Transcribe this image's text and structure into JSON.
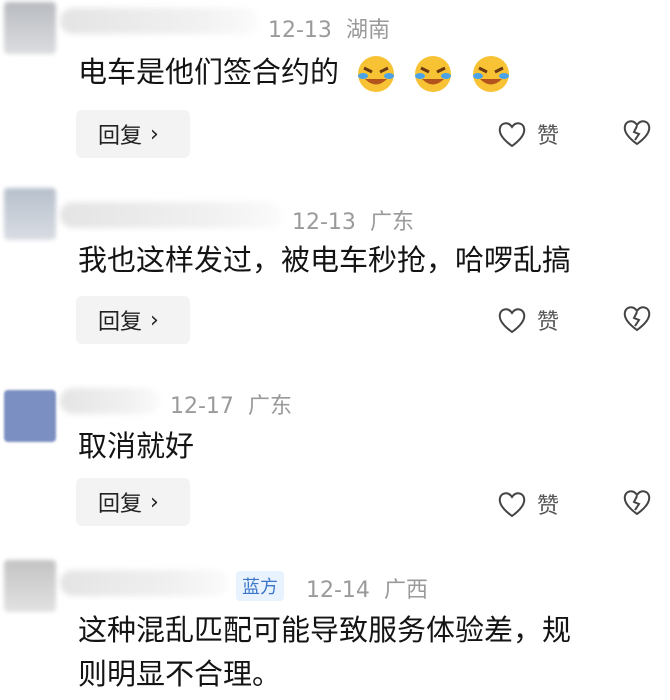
{
  "comments": [
    {
      "date": "12-13",
      "location": "湖南",
      "text": "电车是他们签合约的",
      "emojis": [
        "laughing-crying-emoji",
        "laughing-crying-emoji",
        "laughing-crying-emoji"
      ],
      "reply_label": "回复",
      "like_label": "赞",
      "avatar_color": "#c9cbcf"
    },
    {
      "date": "12-13",
      "location": "广东",
      "text": "我也这样发过，被电车秒抢，哈啰乱搞",
      "reply_label": "回复",
      "like_label": "赞",
      "avatar_color": "#c6cbd4"
    },
    {
      "date": "12-17",
      "location": "广东",
      "text": "取消就好",
      "reply_label": "回复",
      "like_label": "赞",
      "avatar_color": "#7b8fc2"
    },
    {
      "badge": "蓝方",
      "date": "12-14",
      "location": "广西",
      "text_line1": "这种混乱匹配可能导致服务体验差，规",
      "text_line2": "则明显不合理。",
      "avatar_color": "#cfcfcf"
    }
  ],
  "icons": {
    "reply_chevron": "›",
    "like": "heart-outline-icon",
    "dislike": "broken-heart-icon"
  }
}
